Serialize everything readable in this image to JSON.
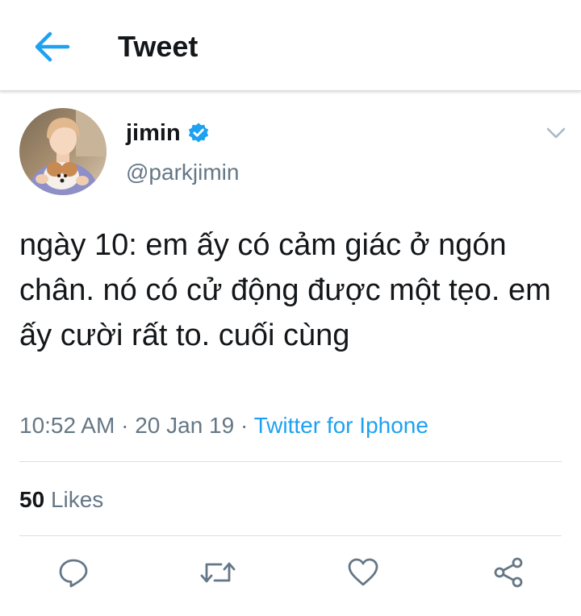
{
  "header": {
    "title": "Tweet",
    "back_icon": "arrow-left-icon",
    "accent_color": "#1da1f2"
  },
  "author": {
    "display_name": "jimin",
    "username": "@parkjimin",
    "verified": true
  },
  "tweet": {
    "text": "ngày 10: em ấy có cảm giác ở ngón chân. nó có cử động được một tẹo. em ấy cười rất to. cuối cùng",
    "time": "10:52 AM",
    "separator": "·",
    "date": "20 Jan 19",
    "source": "Twitter for Iphone"
  },
  "stats": {
    "likes_count": "50",
    "likes_label": "Likes"
  },
  "actions": [
    {
      "icon": "reply-icon"
    },
    {
      "icon": "retweet-icon"
    },
    {
      "icon": "heart-icon"
    },
    {
      "icon": "share-icon"
    }
  ]
}
